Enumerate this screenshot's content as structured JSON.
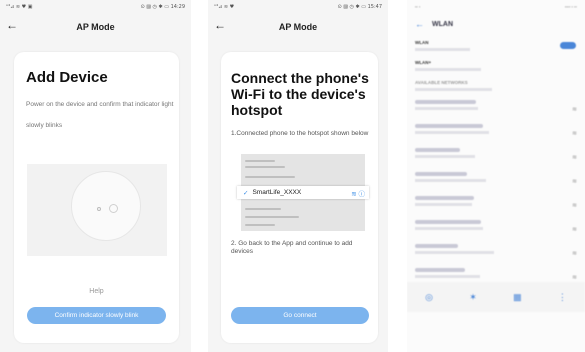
{
  "screen1": {
    "status_left": "ᵒ⁴⊿ ≋ ♥ ▣",
    "status_right": "⊙ ▨ ◷ ✱ ▭ 14:29",
    "nav_title": "AP Mode",
    "heading": "Add Device",
    "description": "Power on the device and confirm that indicator light slowly blinks",
    "help": "Help",
    "button": "Confirm indicator slowly blink"
  },
  "screen2": {
    "status_left": "ᵒ⁴⊿ ≋ ♥",
    "status_right": "⊙ ▨ ◷ ✱ ▭ 15:47",
    "nav_title": "AP Mode",
    "heading": "Connect the phone's Wi-Fi to the device's hotspot",
    "step1": "1.Connected phone to the hotspot shown below",
    "hotspot": "SmartLife_XXXX",
    "step2": "2. Go back to the App and continue to add devices",
    "button": "Go connect"
  },
  "screen3": {
    "title": "WLAN",
    "rows": [
      {
        "t": "WLAN",
        "s": ""
      },
      {
        "t": "WLAN+",
        "s": ""
      },
      {
        "t": "AVAILABLE NETWORKS",
        "s": ""
      },
      {
        "t": "",
        "s": ""
      },
      {
        "t": "",
        "s": ""
      },
      {
        "t": "",
        "s": ""
      },
      {
        "t": "",
        "s": ""
      },
      {
        "t": "",
        "s": ""
      },
      {
        "t": "",
        "s": ""
      },
      {
        "t": "",
        "s": ""
      },
      {
        "t": "",
        "s": ""
      },
      {
        "t": "",
        "s": ""
      }
    ]
  },
  "colors": {
    "button": "#7cb4ee",
    "accent": "#3d8fe6"
  },
  "icons": {
    "back": "back-arrow-icon",
    "wifi": "wifi-icon",
    "info": "info-icon",
    "check": "check-icon"
  }
}
